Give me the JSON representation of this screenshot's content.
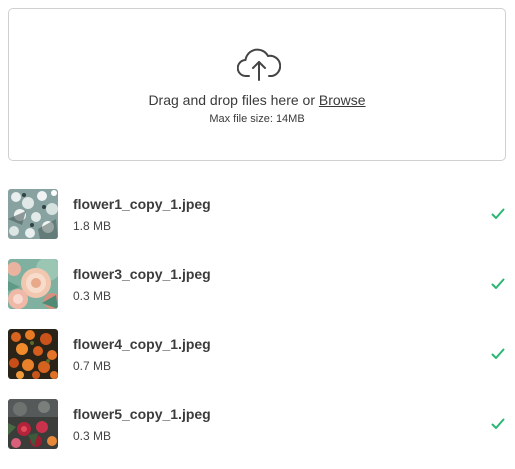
{
  "dropzone": {
    "icon": "cloud-upload-icon",
    "prompt": "Drag and drop files here or",
    "browse_label": "Browse",
    "max_size": "Max file size: 14MB"
  },
  "colors": {
    "border": "#d0d0d0",
    "check": "#2bb673",
    "text": "#333333"
  },
  "files": [
    {
      "name": "flower1_copy_1.jpeg",
      "size": "1.8 MB",
      "thumbnail": "flower-thumbnail-1",
      "status_icon": "check-icon"
    },
    {
      "name": "flower3_copy_1.jpeg",
      "size": "0.3 MB",
      "thumbnail": "flower-thumbnail-3",
      "status_icon": "check-icon"
    },
    {
      "name": "flower4_copy_1.jpeg",
      "size": "0.7 MB",
      "thumbnail": "flower-thumbnail-4",
      "status_icon": "check-icon"
    },
    {
      "name": "flower5_copy_1.jpeg",
      "size": "0.3 MB",
      "thumbnail": "flower-thumbnail-5",
      "status_icon": "check-icon"
    }
  ]
}
